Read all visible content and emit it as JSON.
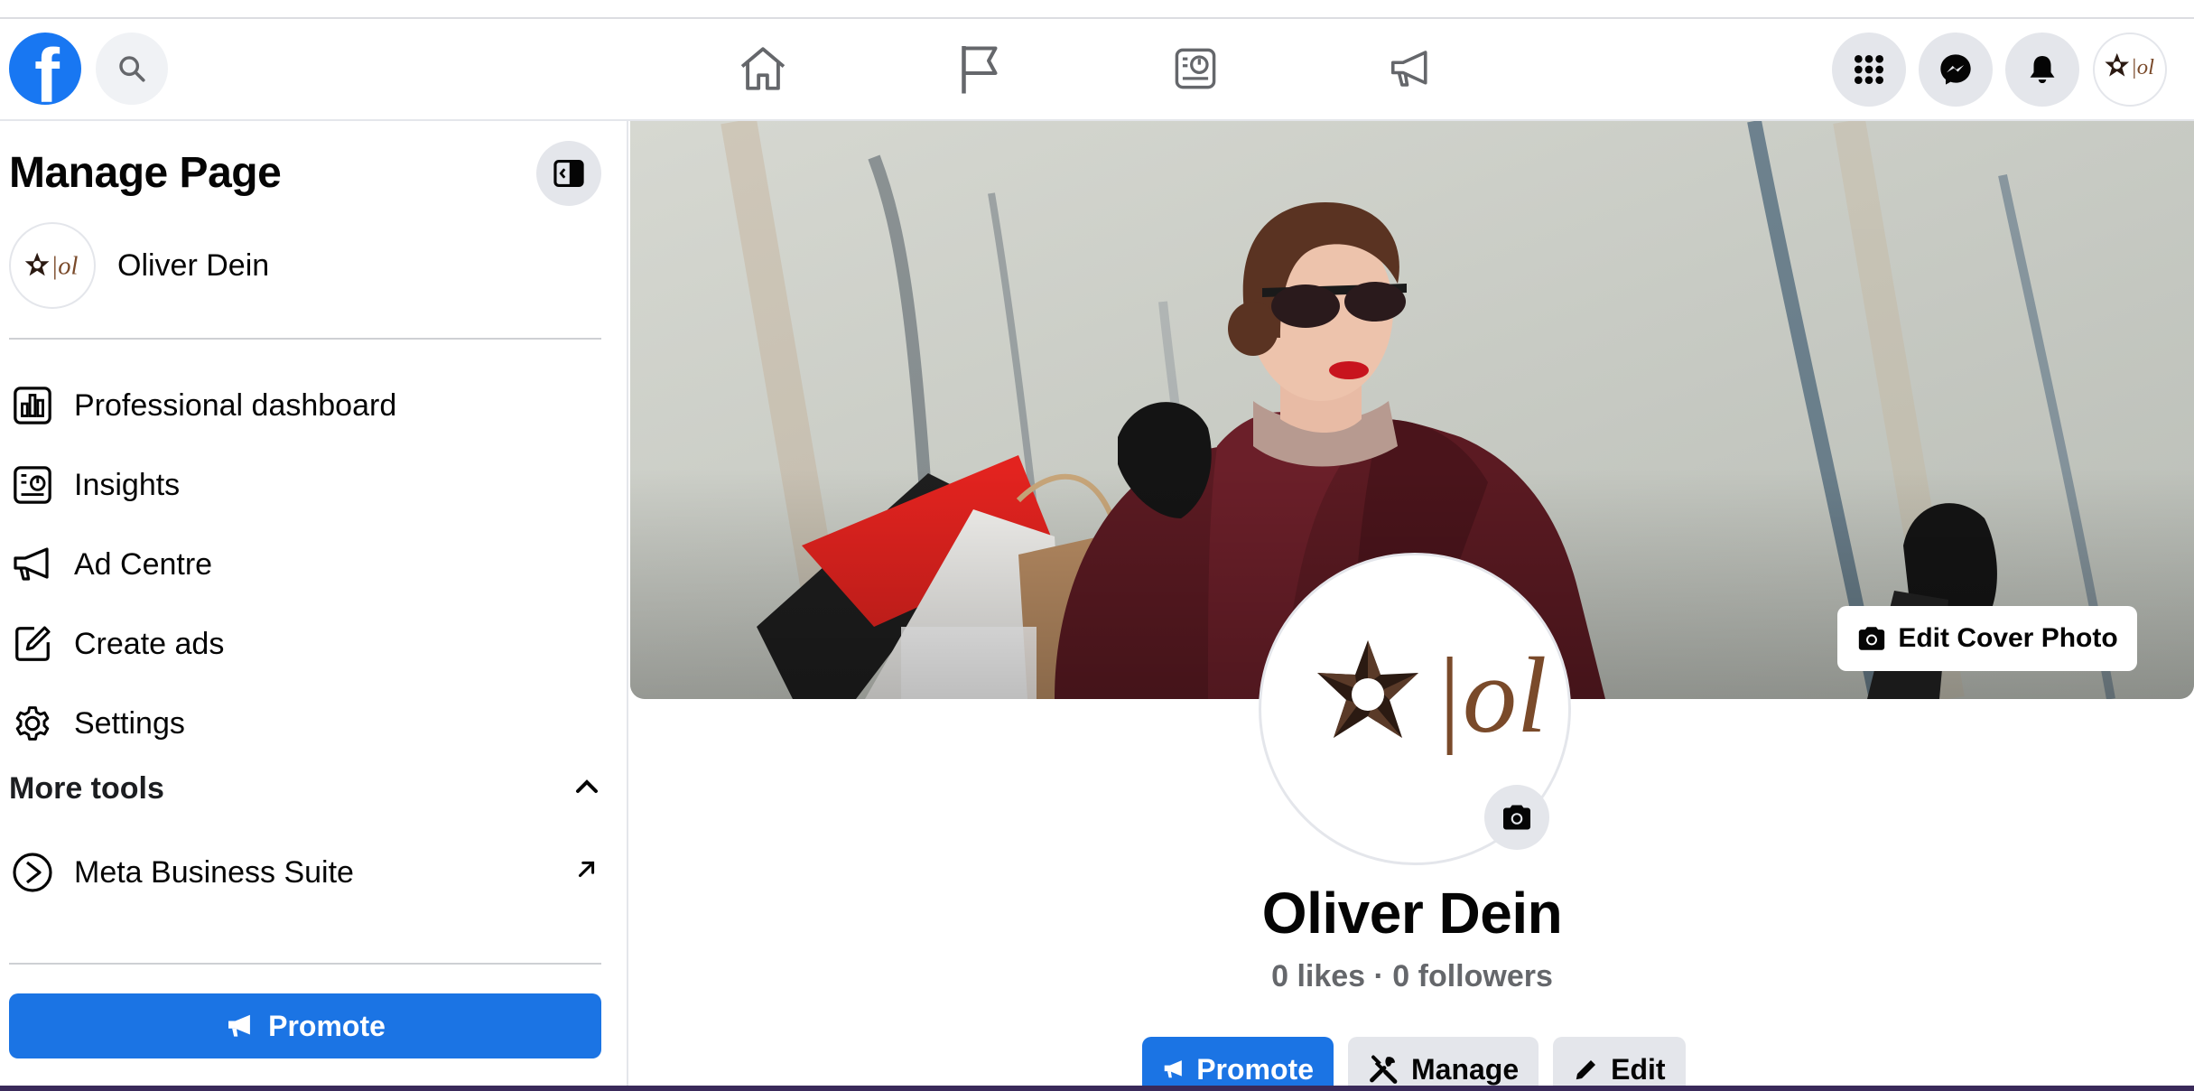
{
  "nav": {
    "logo_letter": "f",
    "icons": [
      "search-icon",
      "home-icon",
      "flag-icon",
      "insights-icon",
      "megaphone-icon",
      "grid-menu-icon",
      "messenger-icon",
      "bell-icon"
    ]
  },
  "sidebar": {
    "title": "Manage Page",
    "page_name": "Oliver Dein",
    "items": [
      {
        "label": "Professional dashboard",
        "icon": "dashboard-icon"
      },
      {
        "label": "Insights",
        "icon": "insights-icon"
      },
      {
        "label": "Ad Centre",
        "icon": "megaphone-icon"
      },
      {
        "label": "Create ads",
        "icon": "edit-icon"
      },
      {
        "label": "Settings",
        "icon": "gear-icon"
      }
    ],
    "more_tools_label": "More tools",
    "more_tools_items": [
      {
        "label": "Meta Business Suite",
        "icon": "meta-business-icon"
      }
    ],
    "promote_label": "Promote"
  },
  "profile": {
    "cover_button_label": "Edit Cover Photo",
    "name": "Oliver Dein",
    "stats": "0 likes · 0 followers",
    "logo_text": "|ol",
    "actions": {
      "promote": "Promote",
      "manage": "Manage",
      "edit": "Edit"
    }
  },
  "colors": {
    "brand_blue": "#1877f2",
    "button_blue": "#1b74e4",
    "logo_brown": "#7a4a2a"
  }
}
